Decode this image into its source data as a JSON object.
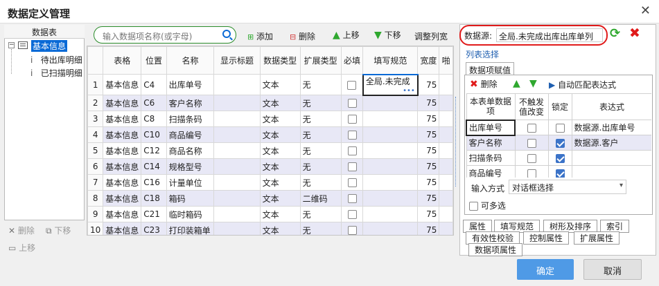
{
  "window": {
    "title": "数据定义管理",
    "close_glyph": "✕"
  },
  "tree": {
    "header": "数据表",
    "root": "基本信息",
    "root_icon": "table-icon",
    "children": [
      "待出库明细",
      "已扫描明细"
    ],
    "delete_label": "删除",
    "down_label": "下移",
    "up_label": "上移"
  },
  "toolbar": {
    "search_placeholder": "输入数据项名称(或字母)",
    "add": "添加",
    "delete": "删除",
    "up": "上移",
    "down": "下移",
    "adjust": "调整列宽"
  },
  "grid": {
    "columns": [
      "表格",
      "位置",
      "名称",
      "显示标题",
      "数据类型",
      "扩展类型",
      "必填",
      "填写规范",
      "宽度",
      "啪"
    ],
    "rows": [
      {
        "n": "1",
        "table": "基本信息",
        "pos": "C4",
        "name": "出库单号",
        "title": "",
        "dtype": "文本",
        "ext": "无",
        "req": false,
        "rule": "全局.未完成",
        "width": "75"
      },
      {
        "n": "2",
        "table": "基本信息",
        "pos": "C6",
        "name": "客户名称",
        "title": "",
        "dtype": "文本",
        "ext": "无",
        "req": false,
        "rule": "",
        "width": "75"
      },
      {
        "n": "3",
        "table": "基本信息",
        "pos": "C8",
        "name": "扫描条码",
        "title": "",
        "dtype": "文本",
        "ext": "无",
        "req": false,
        "rule": "",
        "width": "75"
      },
      {
        "n": "4",
        "table": "基本信息",
        "pos": "C10",
        "name": "商品编号",
        "title": "",
        "dtype": "文本",
        "ext": "无",
        "req": false,
        "rule": "",
        "width": "75"
      },
      {
        "n": "5",
        "table": "基本信息",
        "pos": "C12",
        "name": "商品名称",
        "title": "",
        "dtype": "文本",
        "ext": "无",
        "req": false,
        "rule": "",
        "width": "75"
      },
      {
        "n": "6",
        "table": "基本信息",
        "pos": "C14",
        "name": "规格型号",
        "title": "",
        "dtype": "文本",
        "ext": "无",
        "req": false,
        "rule": "",
        "width": "75"
      },
      {
        "n": "7",
        "table": "基本信息",
        "pos": "C16",
        "name": "计量单位",
        "title": "",
        "dtype": "文本",
        "ext": "无",
        "req": false,
        "rule": "",
        "width": "75"
      },
      {
        "n": "8",
        "table": "基本信息",
        "pos": "C18",
        "name": "箱码",
        "title": "",
        "dtype": "文本",
        "ext": "二维码",
        "req": false,
        "rule": "",
        "width": "75"
      },
      {
        "n": "9",
        "table": "基本信息",
        "pos": "C21",
        "name": "临时箱码",
        "title": "",
        "dtype": "文本",
        "ext": "无",
        "req": false,
        "rule": "",
        "width": "75"
      },
      {
        "n": "10",
        "table": "基本信息",
        "pos": "C23",
        "name": "打印装箱单",
        "title": "",
        "dtype": "文本",
        "ext": "无",
        "req": false,
        "rule": "",
        "width": "75"
      }
    ],
    "ellipsis": "•••"
  },
  "right": {
    "ds_label": "数据源:",
    "ds_value": "全局.未完成出库出库单列",
    "list_select": "列表选择",
    "tab_active": "数据项赋值",
    "delete": "删除",
    "auto_match": "自动匹配表达式",
    "table_headers": [
      "本表单数据项",
      "不触发值改变",
      "锁定",
      "表达式"
    ],
    "table_rows": [
      {
        "item": "出库单号",
        "no_trigger": false,
        "lock": false,
        "expr": "数据源.出库单号"
      },
      {
        "item": "客户名称",
        "no_trigger": false,
        "lock": true,
        "expr": "数据源.客户"
      },
      {
        "item": "扫描条码",
        "no_trigger": false,
        "lock": true,
        "expr": ""
      },
      {
        "item": "商品编号",
        "no_trigger": false,
        "lock": true,
        "expr": ""
      }
    ],
    "input_mode_label": "输入方式",
    "input_mode_value": "对话框选择",
    "multi_label": "可多选",
    "tabs_row1": [
      "属性",
      "填写规范",
      "树形及排序",
      "索引"
    ],
    "tabs_row2": [
      "有效性校验",
      "控制属性",
      "扩展属性"
    ],
    "tabs_row3": [
      "数据项属性"
    ]
  },
  "footer": {
    "ok": "确定",
    "cancel": "取消"
  },
  "colors": {
    "accent": "#0a6ad6",
    "danger": "#e01a1a",
    "green": "#2fa82f"
  }
}
